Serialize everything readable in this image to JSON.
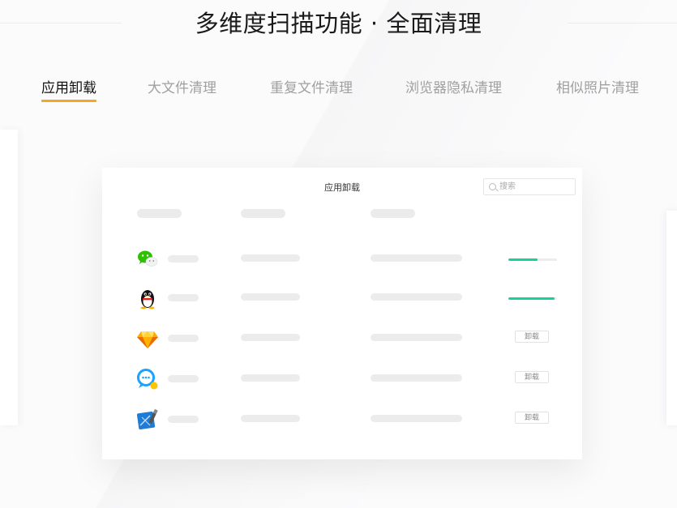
{
  "headline": "多维度扫描功能 · 全面清理",
  "tabs": [
    {
      "label": "应用卸载",
      "active": true
    },
    {
      "label": "大文件清理",
      "active": false
    },
    {
      "label": "重复文件清理",
      "active": false
    },
    {
      "label": "浏览器隐私清理",
      "active": false
    },
    {
      "label": "相似照片清理",
      "active": false
    }
  ],
  "panel": {
    "title": "应用卸载",
    "search_placeholder": "搜索",
    "rows": [
      {
        "app_icon": "wechat-icon",
        "action": "progress",
        "progress": 0.6
      },
      {
        "app_icon": "qq-penguin-icon",
        "action": "progress",
        "progress": 0.95
      },
      {
        "app_icon": "sketch-diamond-icon",
        "action": "button",
        "button_label": "卸载"
      },
      {
        "app_icon": "chat-bubble-icon",
        "action": "button",
        "button_label": "卸载"
      },
      {
        "app_icon": "xcode-icon",
        "action": "button",
        "button_label": "卸载"
      }
    ]
  },
  "colors": {
    "accent_underline": "#f5a623",
    "progress_green": "#15d29a",
    "active_tab_text": "#111111",
    "inactive_tab_text": "#a0a0a0"
  }
}
